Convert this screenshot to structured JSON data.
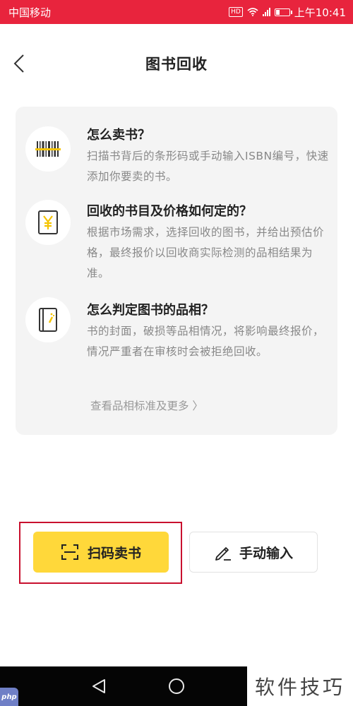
{
  "status_bar": {
    "carrier": "中国移动",
    "network": "HD",
    "time": "上午10:41"
  },
  "header": {
    "title": "图书回收"
  },
  "info": {
    "items": [
      {
        "title": "怎么卖书？",
        "desc": "扫描书背后的条形码或手动输入ISBN编号，快速添加你要卖的书。",
        "icon": "barcode-icon"
      },
      {
        "title": "回收的书目及价格如何定的？",
        "desc": "根据市场需求，选择回收的图书，并给出预估价格，最终报价以回收商实际检测的品相结果为准。",
        "icon": "yuan-price-icon"
      },
      {
        "title": "怎么判定图书的品相？",
        "desc": "书的封面，破损等品相情况，将影响最终报价，情况严重者在审核时会被拒绝回收。",
        "icon": "book-condition-icon"
      }
    ],
    "more_link": "查看品相标准及更多 〉"
  },
  "actions": {
    "scan_label": "扫码卖书",
    "manual_label": "手动输入"
  },
  "watermark": {
    "text": "软件技巧",
    "logo_text": "php"
  },
  "colors": {
    "status_bar": "#e8243d",
    "accent": "#ffd83a",
    "icon_accent": "#f5c400",
    "highlight": "#c8102e"
  }
}
